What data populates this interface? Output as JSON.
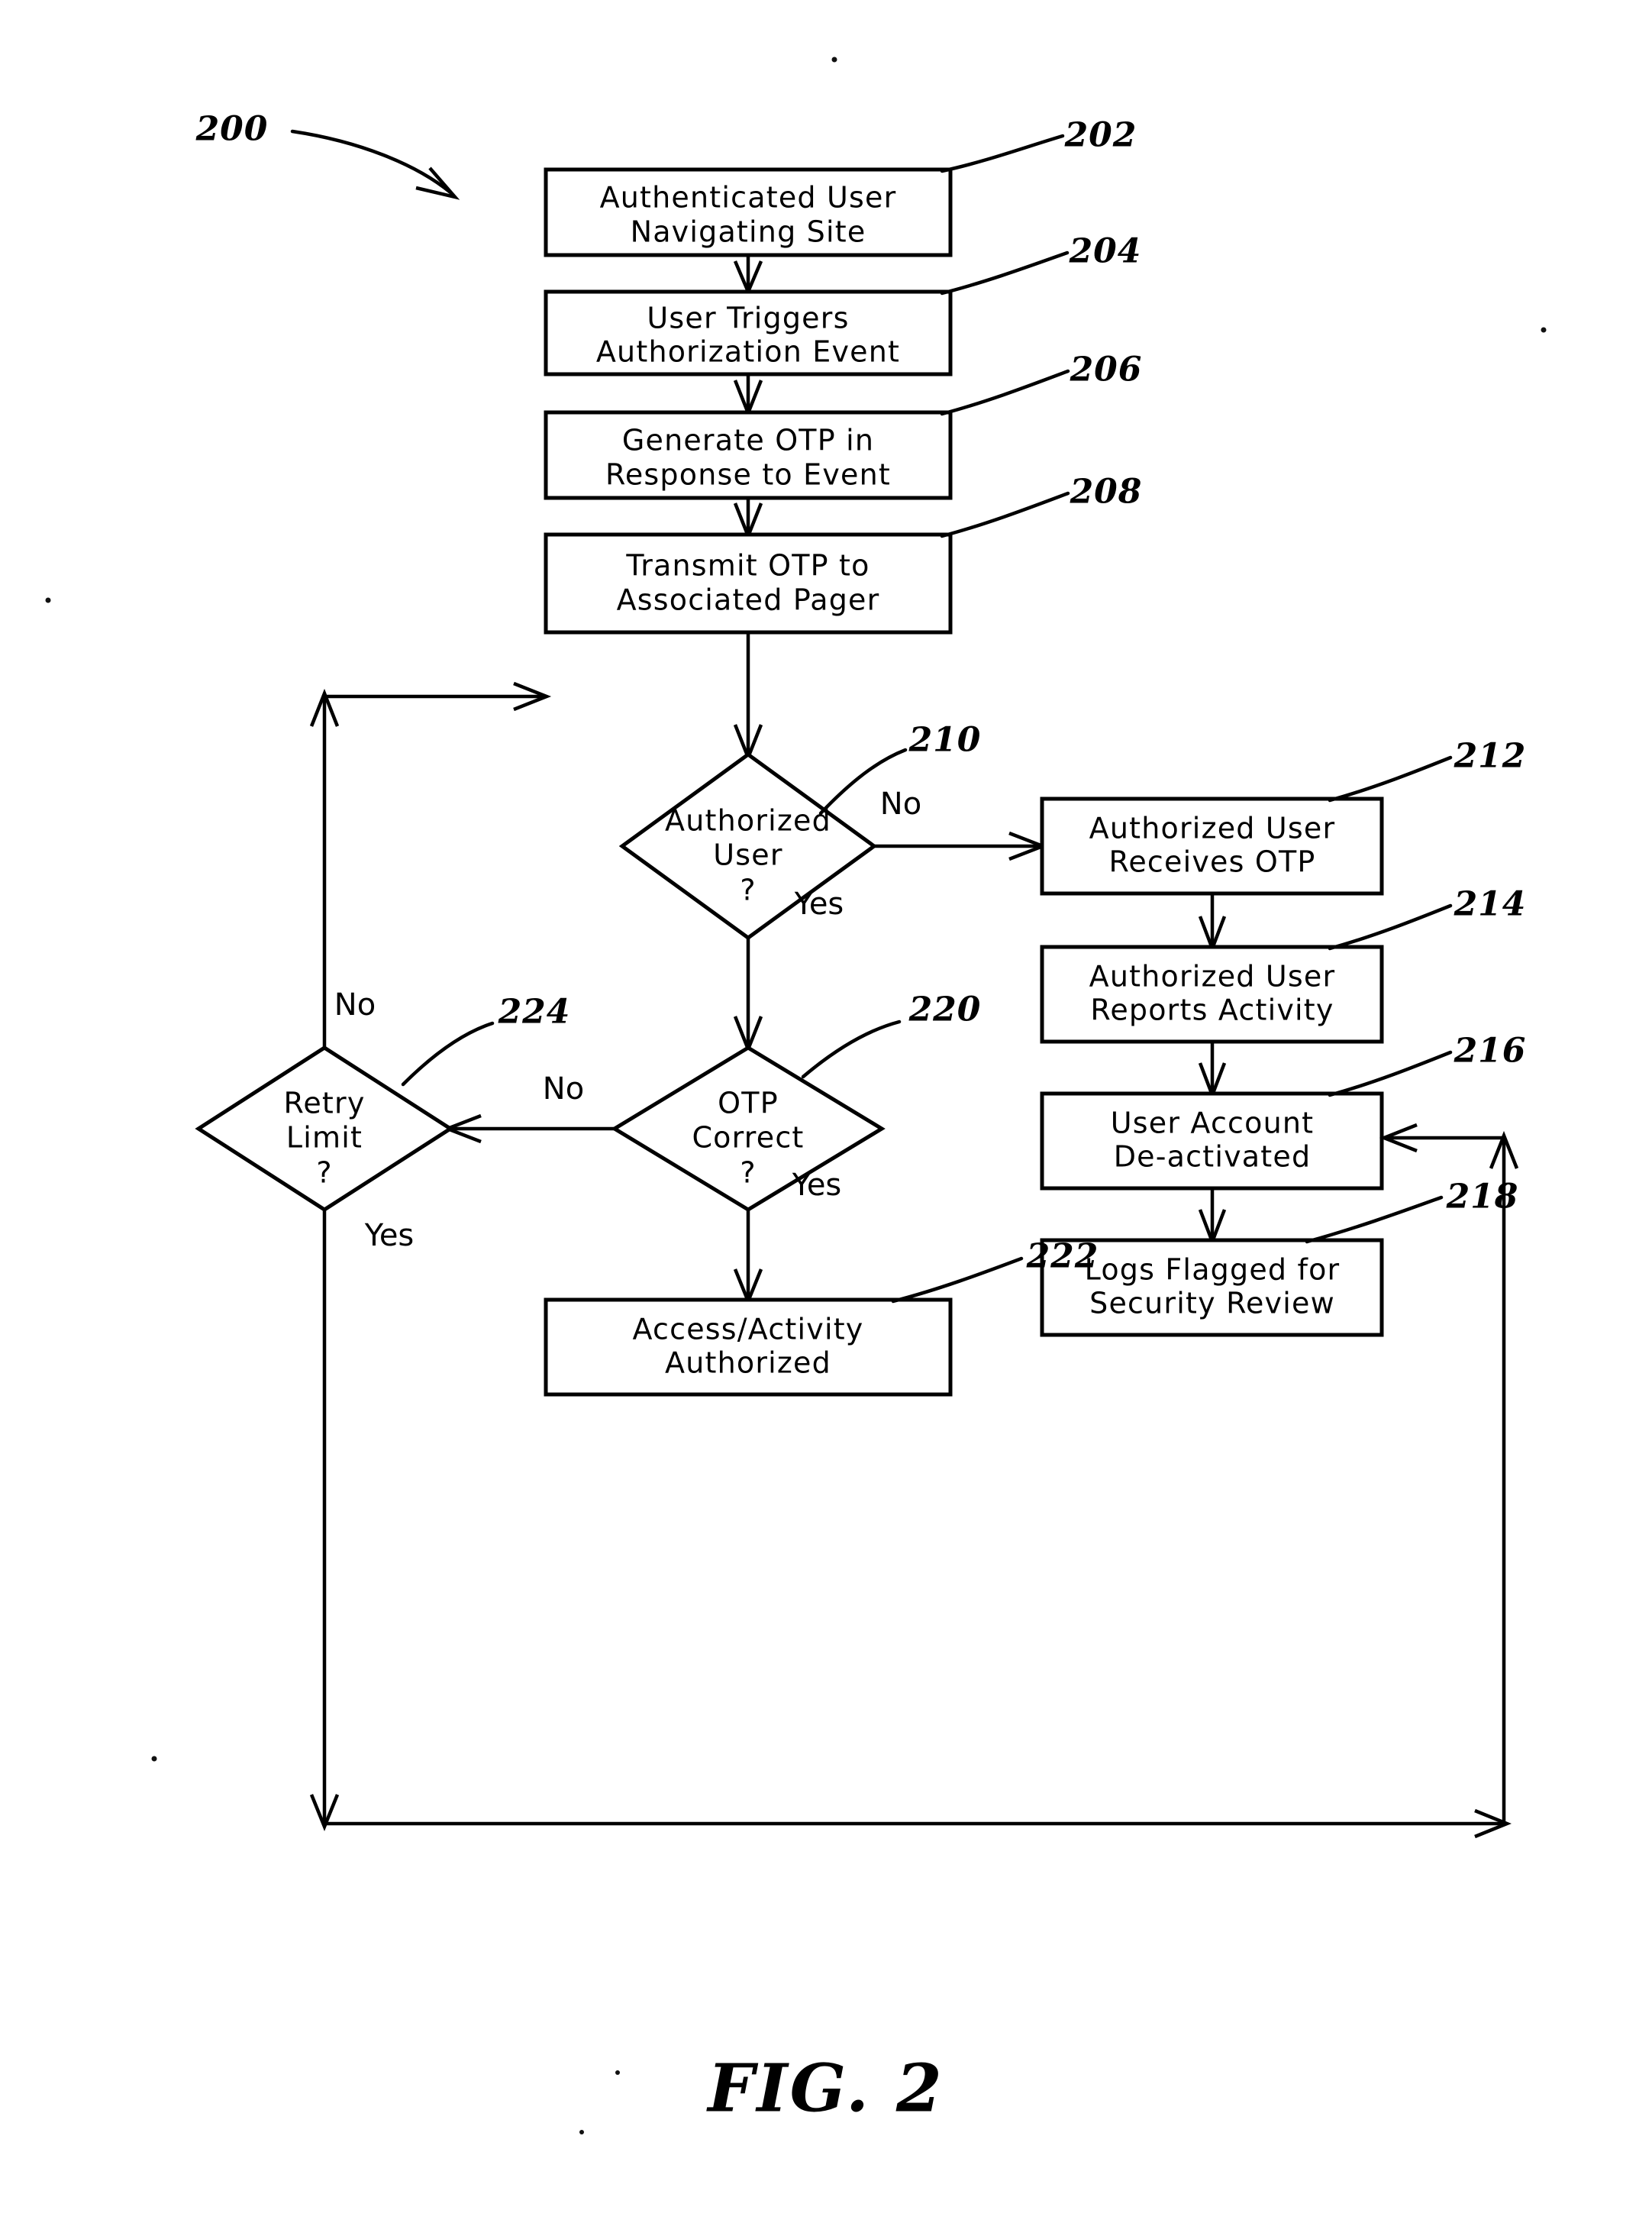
{
  "figure": {
    "caption": "FIG. 2",
    "diagram_ref": "200",
    "type": "flowchart",
    "title_text": "Authenticated User Navigating Site"
  },
  "nodes": {
    "n202": {
      "ref": "202",
      "line1": "Authenticated User",
      "line2": "Navigating Site",
      "shape": "process"
    },
    "n204": {
      "ref": "204",
      "line1": "User Triggers",
      "line2": "Authorization Event",
      "shape": "process"
    },
    "n206": {
      "ref": "206",
      "line1": "Generate OTP in",
      "line2": "Response to Event",
      "shape": "process"
    },
    "n208": {
      "ref": "208",
      "line1": "Transmit OTP to",
      "line2": "Associated Pager",
      "shape": "process"
    },
    "n210": {
      "ref": "210",
      "line1": "Authorized",
      "line2": "User",
      "line3": "?",
      "shape": "decision"
    },
    "n212": {
      "ref": "212",
      "line1": "Authorized User",
      "line2": "Receives OTP",
      "shape": "process"
    },
    "n214": {
      "ref": "214",
      "line1": "Authorized User",
      "line2": "Reports Activity",
      "shape": "process"
    },
    "n216": {
      "ref": "216",
      "line1": "User Account",
      "line2": "De-activated",
      "shape": "process"
    },
    "n218": {
      "ref": "218",
      "line1": "Logs Flagged for",
      "line2": "Security Review",
      "shape": "process"
    },
    "n220": {
      "ref": "220",
      "line1": "OTP",
      "line2": "Correct",
      "line3": "?",
      "shape": "decision"
    },
    "n222": {
      "ref": "222",
      "line1": "Access/Activity",
      "line2": "Authorized",
      "shape": "process"
    },
    "n224": {
      "ref": "224",
      "line1": "Retry",
      "line2": "Limit",
      "line3": "?",
      "shape": "decision"
    }
  },
  "branch_labels": {
    "d210_no": "No",
    "d210_yes": "Yes",
    "d220_no": "No",
    "d220_yes": "Yes",
    "d224_no": "No",
    "d224_yes": "Yes"
  },
  "colors": {
    "ink": "#000000",
    "paper": "#ffffff"
  }
}
